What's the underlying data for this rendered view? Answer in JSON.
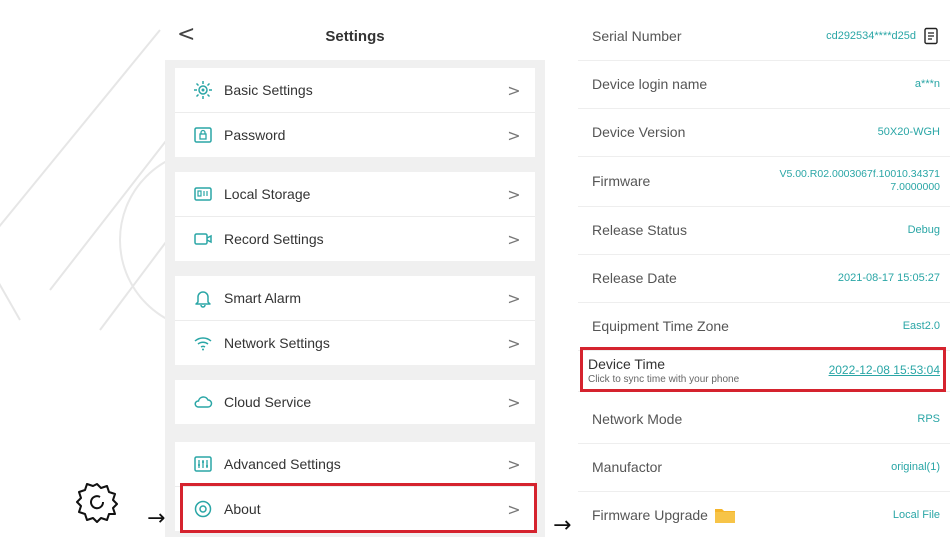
{
  "left": {
    "title": "Settings",
    "groups": [
      [
        {
          "label": "Basic Settings",
          "icon": "sun-gear-icon"
        },
        {
          "label": "Password",
          "icon": "lock-icon"
        }
      ],
      [
        {
          "label": "Local Storage",
          "icon": "sd-card-icon"
        },
        {
          "label": "Record Settings",
          "icon": "video-camera-icon"
        }
      ],
      [
        {
          "label": "Smart Alarm",
          "icon": "bell-icon"
        },
        {
          "label": "Network Settings",
          "icon": "wifi-icon"
        }
      ],
      [
        {
          "label": "Cloud Service",
          "icon": "cloud-icon"
        }
      ],
      [
        {
          "label": "Advanced Settings",
          "icon": "sliders-icon"
        },
        {
          "label": "About",
          "icon": "info-gear-icon"
        }
      ]
    ],
    "chevron": ">",
    "back": "<"
  },
  "arrows": [
    "→",
    "→"
  ],
  "right": {
    "rows": [
      {
        "label": "Serial Number",
        "value": "cd292534****d25d"
      },
      {
        "label": "Device login name",
        "value": "a***n"
      },
      {
        "label": "Device Version",
        "value": "50X20-WGH"
      },
      {
        "label": "Firmware",
        "value": "V5.00.R02.0003067f.10010.34371\n7.0000000"
      },
      {
        "label": "Release Status",
        "value": "Debug"
      },
      {
        "label": "Release Date",
        "value": "2021-08-17 15:05:27"
      },
      {
        "label": "Equipment Time Zone",
        "value": "East2.0"
      },
      {
        "label": "Device Time",
        "value": "2022-12-08 15:53:04",
        "sub": "Click to sync time with your phone"
      },
      {
        "label": "Network Mode",
        "value": "RPS"
      },
      {
        "label": "Manufactor",
        "value": "original(1)"
      },
      {
        "label": "Firmware Upgrade",
        "value": "Local File"
      }
    ]
  },
  "colors": {
    "accent": "#2aa6a6",
    "highlight": "#d5232e",
    "folder": "#f5b52a"
  }
}
